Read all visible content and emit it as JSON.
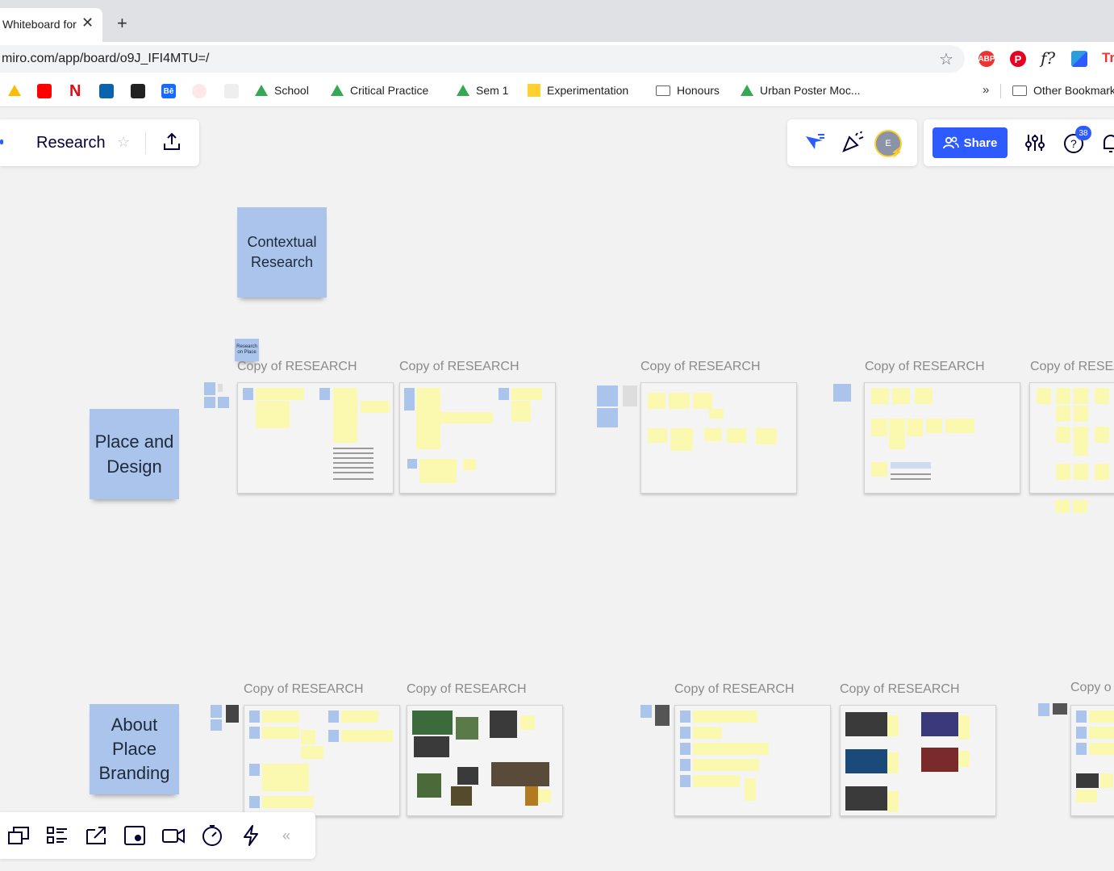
{
  "browser": {
    "tab_title": "Whiteboard for Research",
    "tab_close": "✕",
    "new_tab": "+",
    "url": "miro.com/app/board/o9J_IFI4MTU=/",
    "extensions": [
      "ABP",
      "P",
      "f?",
      "",
      "Tr"
    ],
    "bookmarks": [
      {
        "label": "School",
        "icon": "drive-icon"
      },
      {
        "label": "Critical Practice",
        "icon": "drive-icon"
      },
      {
        "label": "Sem 1",
        "icon": "drive-icon"
      },
      {
        "label": "Experimentation",
        "icon": "miro-icon"
      },
      {
        "label": "Honours",
        "icon": "folder-icon"
      },
      {
        "label": "Urban Poster Moc...",
        "icon": "drive-icon"
      }
    ],
    "bookmarks_overflow": "»",
    "other_bookmarks": "Other Bookmarks"
  },
  "board": {
    "title": "Research",
    "share_label": "Share",
    "avatar_initial": "E",
    "help_badge": "38"
  },
  "canvas": {
    "contextual": "Contextual Research",
    "research_on_place": "Research on Place",
    "place_and_design": "Place and Design",
    "about_place_branding": "About Place Branding",
    "frame_label": "Copy of RESEARCH",
    "frame_label_truncated_1": "Copy of RESEA",
    "frame_label_truncated_2": "Copy o"
  },
  "toolbar": {
    "collapse": "«"
  },
  "colors": {
    "accent": "#2d5bff",
    "sticky_blue": "#aac4ec",
    "sticky_yellow": "#fbf8b0"
  }
}
